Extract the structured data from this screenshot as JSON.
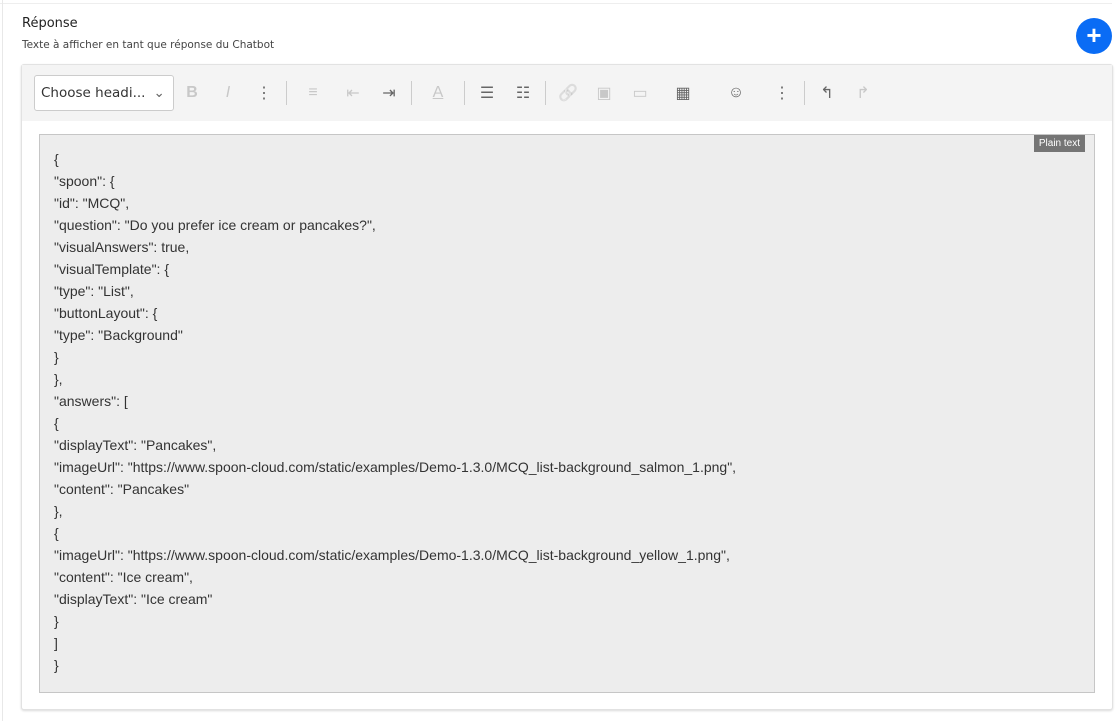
{
  "section": {
    "title": "Réponse",
    "subtitle": "Texte à afficher en tant que réponse du Chatbot"
  },
  "add_button": "+",
  "toolbar": {
    "heading_select": "Choose headi...",
    "bold": "B",
    "italic": "I",
    "more": "⋮",
    "align": "≡",
    "outdent": "⇤",
    "indent": "⇥",
    "font_color": "A",
    "bullet_list": "☰",
    "numbered_list": "☷",
    "link": "🔗",
    "image": "▣",
    "file": "▭",
    "table": "▦",
    "emoji": "☺",
    "more2": "⋮",
    "undo": "↰",
    "redo": "↱",
    "chevron": "⌄"
  },
  "code_block": {
    "badge": "Plain text",
    "lines": [
      "{",
      "\"spoon\": {",
      "\"id\": \"MCQ\",",
      "\"question\": \"Do you prefer ice cream or pancakes?\",",
      "\"visualAnswers\": true,",
      "\"visualTemplate\": {",
      "\"type\": \"List\",",
      "\"buttonLayout\": {",
      "\"type\": \"Background\"",
      "}",
      "},",
      "\"answers\": [",
      "{",
      "\"displayText\": \"Pancakes\",",
      "\"imageUrl\": \"https://www.spoon-cloud.com/static/examples/Demo-1.3.0/MCQ_list-background_salmon_1.png\",",
      "\"content\": \"Pancakes\"",
      "},",
      "{",
      "\"imageUrl\": \"https://www.spoon-cloud.com/static/examples/Demo-1.3.0/MCQ_list-background_yellow_1.png\",",
      "\"content\": \"Ice cream\",",
      "\"displayText\": \"Ice cream\"",
      "}",
      "]",
      "}"
    ]
  },
  "colors": {
    "accent": "#0a6cf5"
  }
}
